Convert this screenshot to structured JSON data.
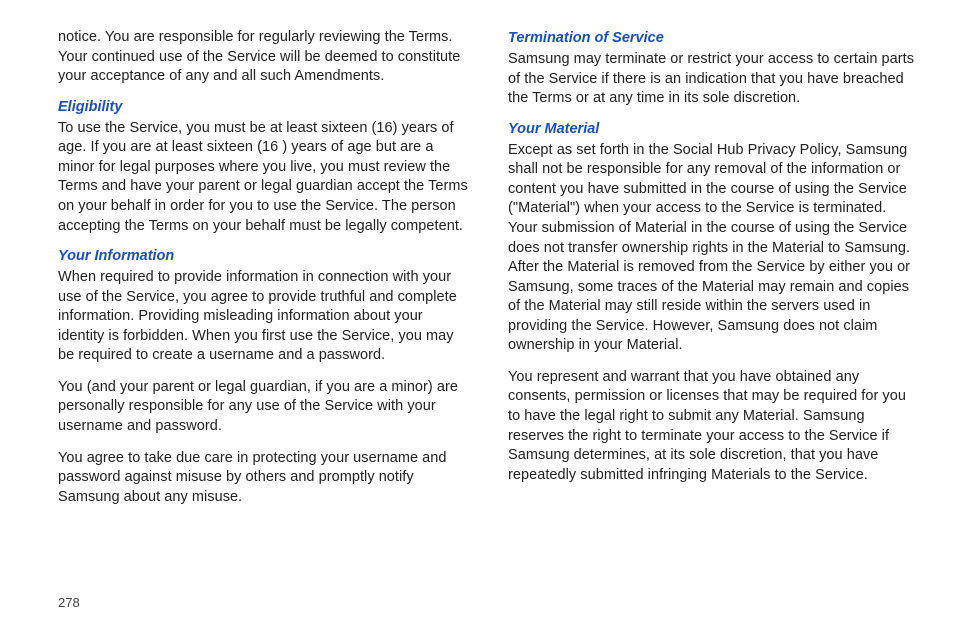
{
  "page_number": "278",
  "left": {
    "intro": "notice. You are responsible for regularly reviewing the Terms. Your continued use of the Service will be deemed to constitute your acceptance of any and all such Amendments.",
    "eligibility_head": "Eligibility",
    "eligibility_body": "To use the Service, you must be at least sixteen (16) years of age. If you are at least sixteen (16 ) years of age but are a minor for legal purposes where you live, you must review the Terms and have your parent or legal guardian accept the Terms on your behalf in order for you to use the Service. The person accepting the Terms on your behalf must be legally competent.",
    "yourinfo_head": "Your Information",
    "yourinfo_p1": "When required to provide information in connection with your use of the Service, you agree to provide truthful and complete information.  Providing misleading information about your identity is forbidden. When you first use the Service, you may be required to create a username and a password.",
    "yourinfo_p2": "You (and your parent or legal guardian, if you are a minor) are personally responsible for any use of the Service with your username and password.",
    "yourinfo_p3": "You agree to take due care in protecting your username and password against misuse by others and promptly notify Samsung about any misuse."
  },
  "right": {
    "termination_head": "Termination of Service",
    "termination_body": "Samsung may terminate or restrict your access to certain parts of the Service if there is an indication that you have breached the Terms or at any time in its sole discretion.",
    "material_head": "Your Material",
    "material_p1": "Except as set forth in the Social Hub Privacy Policy, Samsung shall not be responsible for any removal of the information or content you have submitted in the course of using the Service (\"Material\") when your access to the Service is terminated. Your submission of Material in the course of using the Service does not transfer ownership rights in the Material to Samsung. After the Material is removed from the Service by either you or Samsung, some traces of the Material may remain and copies of the Material may still reside within the servers used in providing the Service. However, Samsung does not claim ownership in your Material.",
    "material_p2": "You represent and warrant that you have obtained any consents, permission or licenses that may be required for you to have the legal right to submit any Material. Samsung reserves the right to terminate your access to the Service if Samsung determines, at its sole discretion, that you have repeatedly submitted infringing Materials to the Service."
  }
}
